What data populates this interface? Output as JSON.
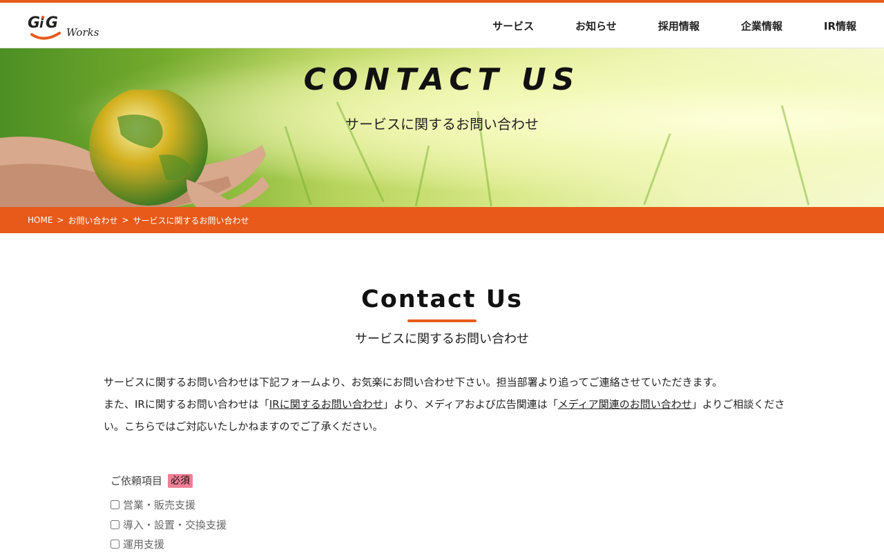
{
  "header": {
    "logo_text": "GiG Works",
    "nav": [
      "サービス",
      "お知らせ",
      "採用情報",
      "企業情報",
      "IR情報"
    ]
  },
  "hero": {
    "title": "CONTACT US",
    "subtitle": "サービスに関するお問い合わせ"
  },
  "breadcrumb": {
    "items": [
      "HOME",
      "お問い合わせ",
      "サービスに関するお問い合わせ"
    ],
    "separator": ">"
  },
  "section": {
    "title": "Contact Us",
    "subtitle": "サービスに関するお問い合わせ"
  },
  "intro": {
    "line1": "サービスに関するお問い合わせは下記フォームより、お気楽にお問い合わせ下さい。担当部署より追ってご連絡させていただきます。",
    "line2_a": "また、IRに関するお問い合わせは「",
    "link_ir": "IRに関するお問い合わせ",
    "line2_b": "」より、メディアおよび広告関連は「",
    "link_media": "メディア関連のお問い合わせ",
    "line2_c": "」よりご相談ください。こちらではご対応いたしかねますのでご了承ください。"
  },
  "form": {
    "request_label": "ご依頼項目",
    "required_badge": "必須",
    "options": [
      "営業・販売支援",
      "導入・設置・交換支援",
      "運用支援"
    ]
  },
  "colors": {
    "accent": "#e85a1a",
    "required_badge_bg": "#ef7f96"
  }
}
